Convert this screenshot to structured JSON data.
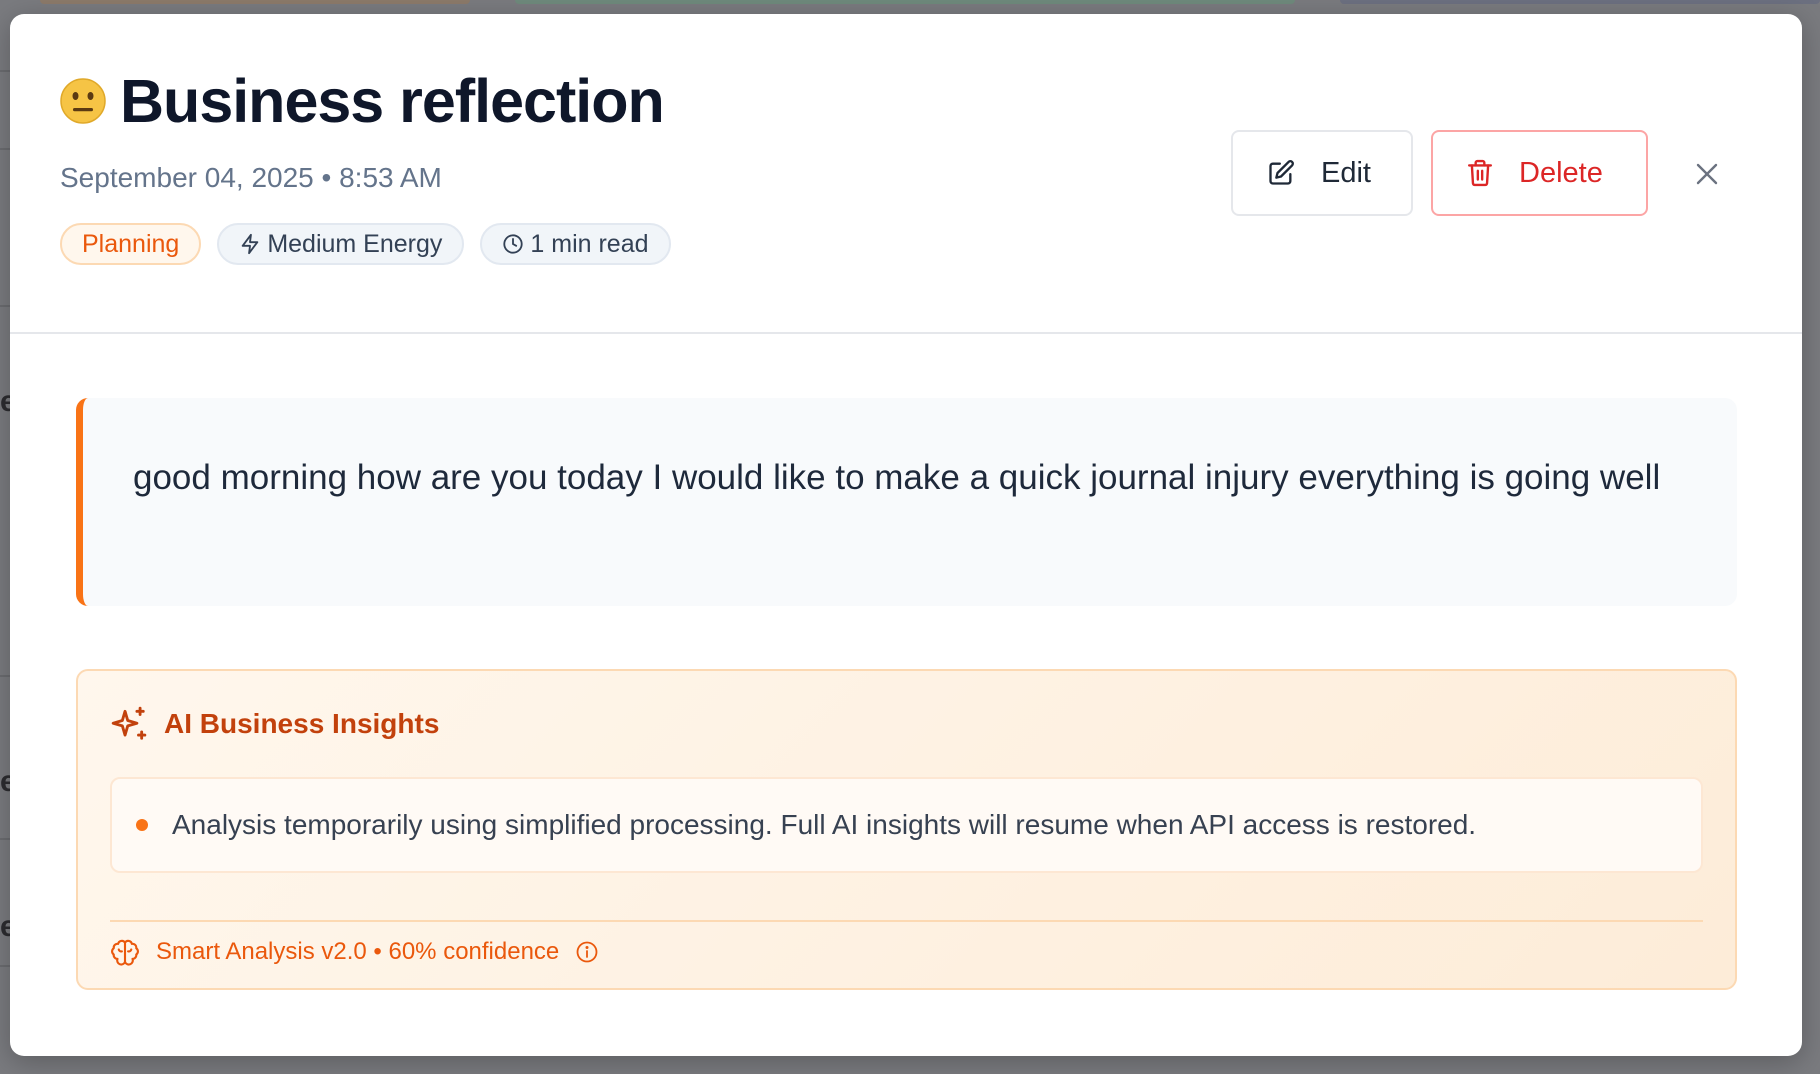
{
  "entry": {
    "mood_emoji": "neutral-face",
    "title": "Business reflection",
    "datetime": "September 04, 2025 • 8:53 AM",
    "tags": {
      "category": "Planning",
      "energy": "Medium Energy",
      "read_time": "1 min read"
    },
    "body": "good morning how are you today I would like to make a quick journal injury everything is going well"
  },
  "actions": {
    "edit_label": "Edit",
    "delete_label": "Delete"
  },
  "insights": {
    "title": "AI Business Insights",
    "items": [
      "Analysis temporarily using simplified processing. Full AI insights will resume when API access is restored."
    ],
    "footer": "Smart Analysis v2.0 • 60% confidence",
    "confidence": 0.6
  },
  "colors": {
    "accent": "#f97316",
    "danger": "#dc2626",
    "title": "#0f172a"
  },
  "icons": [
    "neutral-face-emoji",
    "pencil-square-icon",
    "trash-icon",
    "close-icon",
    "lightning-icon",
    "clock-icon",
    "sparkles-icon",
    "brain-icon",
    "info-icon"
  ]
}
